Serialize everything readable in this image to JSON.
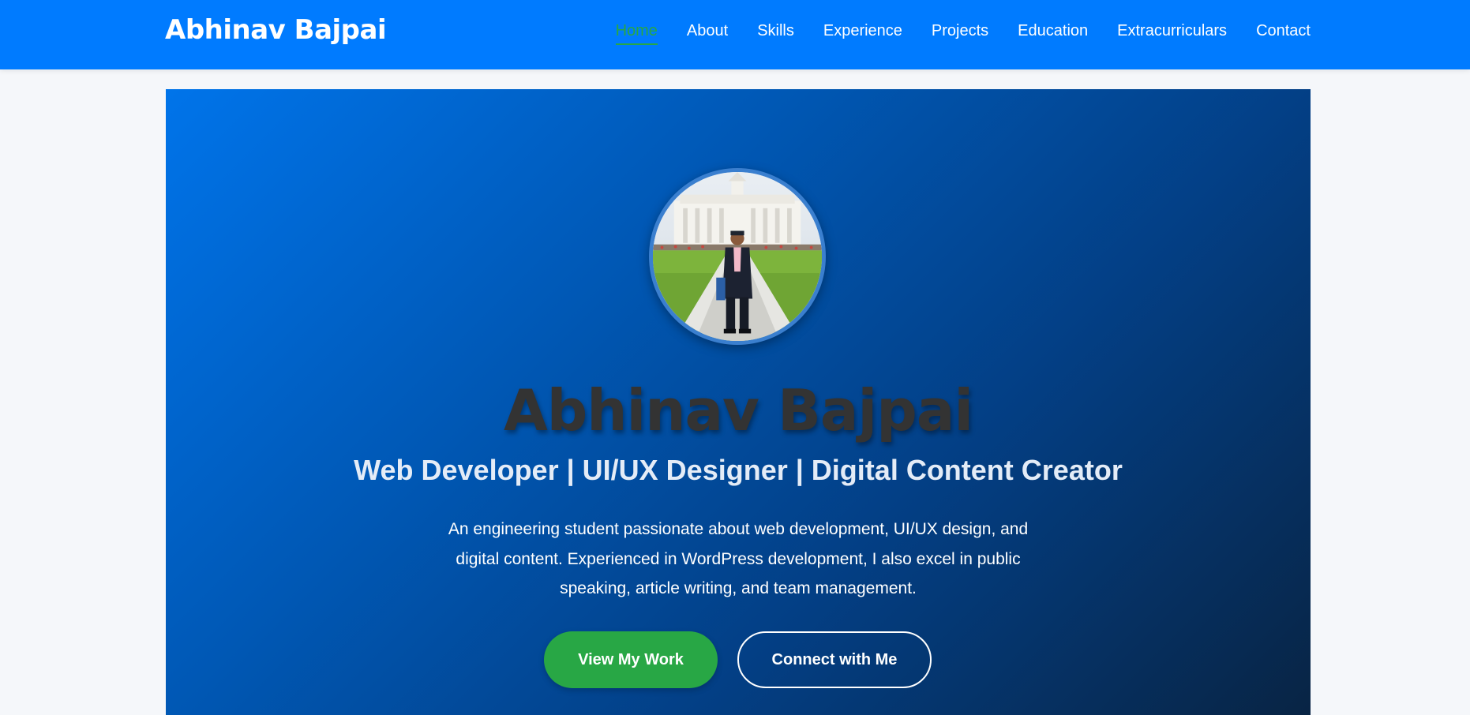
{
  "navbar": {
    "brand": "Abhinav Bajpai",
    "links": [
      {
        "label": "Home",
        "active": true
      },
      {
        "label": "About"
      },
      {
        "label": "Skills"
      },
      {
        "label": "Experience"
      },
      {
        "label": "Projects"
      },
      {
        "label": "Education"
      },
      {
        "label": "Extracurriculars"
      },
      {
        "label": "Contact"
      }
    ]
  },
  "hero": {
    "name": "Abhinav Bajpai",
    "tagline": "Web Developer | UI/UX Designer | Digital Content Creator",
    "description": "An engineering student passionate about web development, UI/UX design, and digital content. Experienced in WordPress development, I also excel in public speaking, article writing, and team management.",
    "primary_button": "View My Work",
    "secondary_button": "Connect with Me",
    "avatar_icon": "profile-photo"
  },
  "colors": {
    "navbar_bg": "#007bff",
    "accent_green": "#28a745",
    "page_bg": "#f5f7fa",
    "name_text": "#333333"
  }
}
